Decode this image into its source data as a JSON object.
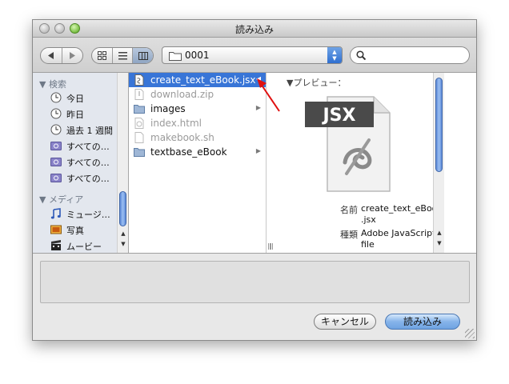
{
  "window": {
    "title": "読み込み"
  },
  "toolbar": {
    "location": "0001",
    "search_value": ""
  },
  "sidebar": {
    "sections": [
      {
        "label": "検索",
        "items": [
          {
            "label": "今日",
            "icon": "clock-icon"
          },
          {
            "label": "昨日",
            "icon": "clock-icon"
          },
          {
            "label": "過去 1 週間",
            "icon": "clock-icon"
          },
          {
            "label": "すべての…",
            "icon": "smart-folder-icon"
          },
          {
            "label": "すべての…",
            "icon": "smart-folder-icon"
          },
          {
            "label": "すべての…",
            "icon": "smart-folder-icon"
          }
        ]
      },
      {
        "label": "メディア",
        "items": [
          {
            "label": "ミュージ…",
            "icon": "music-note-icon"
          },
          {
            "label": "写真",
            "icon": "photo-icon"
          },
          {
            "label": "ムービー",
            "icon": "movie-icon"
          }
        ]
      }
    ]
  },
  "files": [
    {
      "name": "create_text_eBook.jsx",
      "kind": "file",
      "selected": true,
      "enabled": true
    },
    {
      "name": "download.zip",
      "kind": "file",
      "selected": false,
      "enabled": false
    },
    {
      "name": "images",
      "kind": "folder",
      "selected": false,
      "enabled": true
    },
    {
      "name": "index.html",
      "kind": "file",
      "selected": false,
      "enabled": false
    },
    {
      "name": "makebook.sh",
      "kind": "file",
      "selected": false,
      "enabled": false
    },
    {
      "name": "textbase_eBook",
      "kind": "folder",
      "selected": false,
      "enabled": true
    }
  ],
  "preview": {
    "header": "▼プレビュー：",
    "icon_label": "JSX",
    "name_label": "名前",
    "name_value_line1": "create_text_eBook",
    "name_value_line2": ".jsx",
    "kind_label": "種類",
    "kind_value_line1": "Adobe JavaScript",
    "kind_value_line2": "file"
  },
  "buttons": {
    "cancel": "キャンセル",
    "open": "読み込み"
  },
  "colors": {
    "selection": "#3875d7",
    "annotation_arrow": "#e01010"
  }
}
